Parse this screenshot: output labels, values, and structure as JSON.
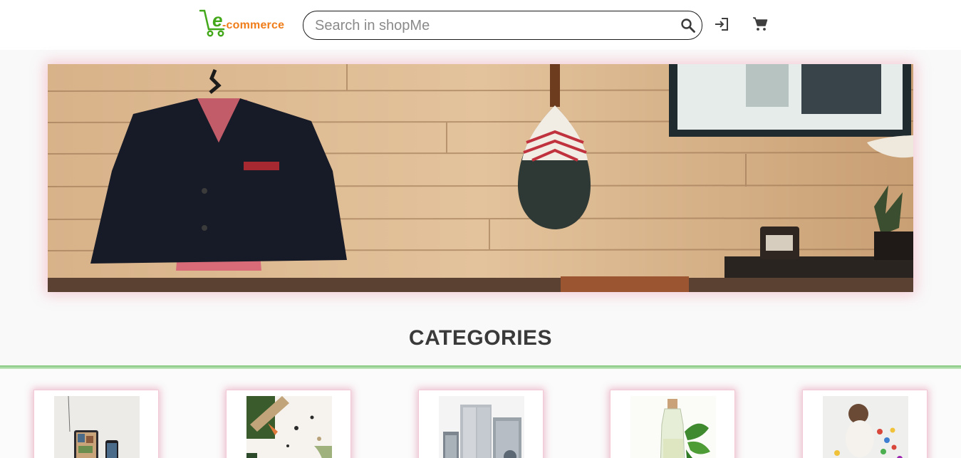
{
  "header": {
    "logo_text": "commerce",
    "logo_letter": "e",
    "logo_dash": "-",
    "search_placeholder": "Search in shopMe",
    "icons": [
      "search-icon",
      "login-icon",
      "cart-icon"
    ]
  },
  "banner": {
    "subject": "jacket-and-paddle-on-wood-wall"
  },
  "categories": {
    "title": "CATEGORIES",
    "items": [
      {
        "thumb": "electronics-devices"
      },
      {
        "thumb": "art-supplies"
      },
      {
        "thumb": "home-appliances"
      },
      {
        "thumb": "oil-and-plant"
      },
      {
        "thumb": "toys-kid"
      }
    ]
  },
  "colors": {
    "logo_orange": "#ef7d1a",
    "logo_green": "#43a71a",
    "rule_green": "#7fc67a",
    "card_glow": "#d2507a"
  }
}
